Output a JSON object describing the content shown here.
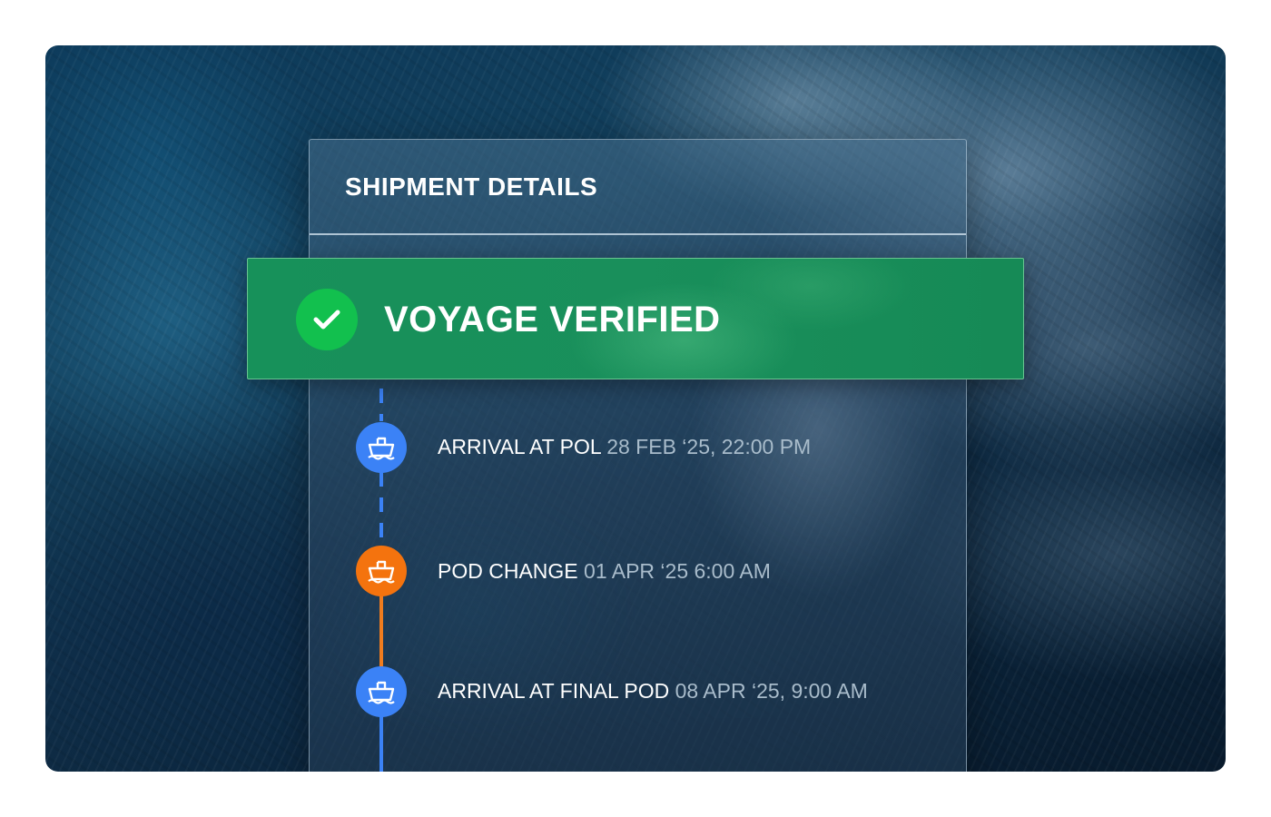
{
  "panel": {
    "title": "SHIPMENT DETAILS"
  },
  "status_banner": {
    "label": "VOYAGE VERIFIED",
    "icon": "check-icon",
    "color": "#17915a",
    "icon_color": "#12c04e"
  },
  "timeline": {
    "events": [
      {
        "label": "ARRIVAL AT POL",
        "time": "28 FEB ‘25, 22:00 PM",
        "icon": "ship-icon",
        "color": "#3b82f6"
      },
      {
        "label": "POD CHANGE",
        "time": "01 APR ‘25 6:00 AM",
        "icon": "ship-icon",
        "color": "#f4730e"
      },
      {
        "label": "ARRIVAL AT FINAL POD",
        "time": "08 APR ‘25, 9:00 AM",
        "icon": "ship-icon",
        "color": "#3b82f6"
      }
    ]
  }
}
